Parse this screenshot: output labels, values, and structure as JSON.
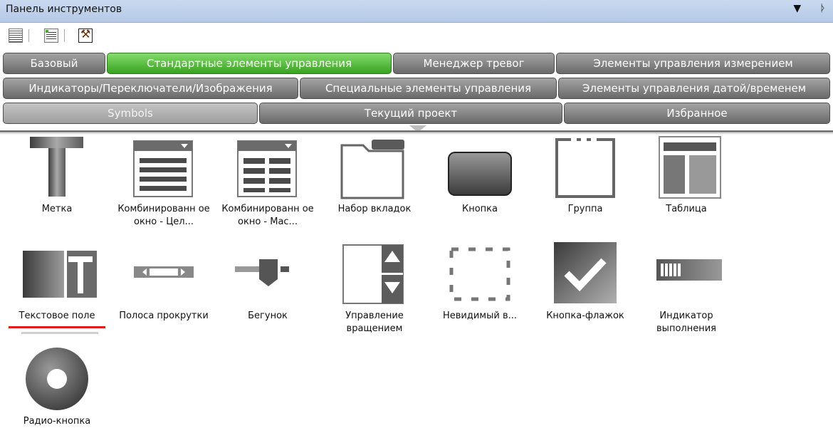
{
  "panel": {
    "title": "Панель инструментов",
    "dropdown_glyph": "▼",
    "pin_glyph": "🖈"
  },
  "toolbar": {
    "icons": [
      "list-view-icon",
      "grid-view-icon",
      "brush-icon"
    ]
  },
  "tabs": {
    "row1": [
      "Базовый",
      "Стандартные элементы управления",
      "Менеджер тревог",
      "Элементы управления измерением"
    ],
    "row2": [
      "Индикаторы/Переключатели/Изображения",
      "Специальные элементы управления",
      "Элементы управления датой/временем"
    ],
    "row3": [
      "Symbols",
      "Текущий проект",
      "Избранное"
    ],
    "active": "Стандартные элементы управления"
  },
  "items": [
    {
      "label": "Метка",
      "icon": "label-icon"
    },
    {
      "label": "Комбинированн ое окно - Цел...",
      "icon": "combobox-icon"
    },
    {
      "label": "Комбинированн ое окно - Мас...",
      "icon": "combobox-array-icon"
    },
    {
      "label": "Набор вкладок",
      "icon": "tabset-icon"
    },
    {
      "label": "Кнопка",
      "icon": "button-icon"
    },
    {
      "label": "Группа",
      "icon": "group-icon"
    },
    {
      "label": "Таблица",
      "icon": "table-icon"
    },
    {
      "label": "Текстовое поле",
      "icon": "textbox-icon"
    },
    {
      "label": "Полоса прокрутки",
      "icon": "scrollbar-icon"
    },
    {
      "label": "Бегунок",
      "icon": "slider-icon"
    },
    {
      "label": "Управление вращением",
      "icon": "spin-control-icon"
    },
    {
      "label": "Невидимый в...",
      "icon": "invisible-icon"
    },
    {
      "label": "Кнопка-флажок",
      "icon": "checkbox-button-icon"
    },
    {
      "label": "Индикатор выполнения",
      "icon": "progress-bar-icon"
    },
    {
      "label": "Радио-кнопка",
      "icon": "radio-button-icon"
    }
  ],
  "colors": {
    "active_tab": "#39a220",
    "inactive_tab": "#6a6a6a",
    "highlight_underline": "#e31b1b"
  }
}
